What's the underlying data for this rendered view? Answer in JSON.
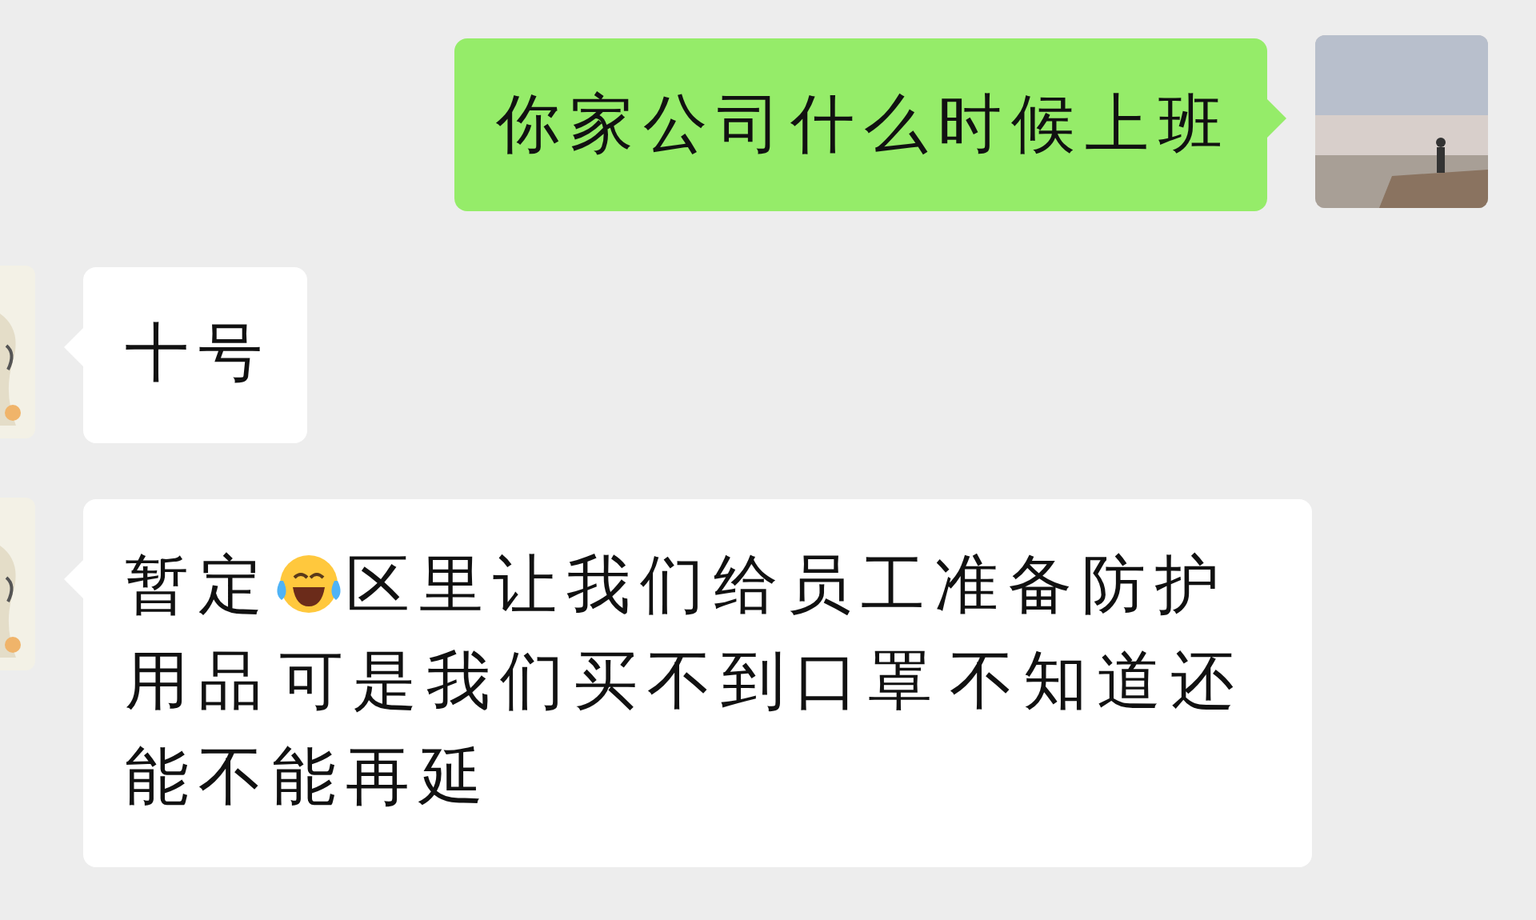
{
  "messages": [
    {
      "kind": "sent",
      "parts": [
        {
          "kind": "text",
          "text": "你家公司什么时候上班"
        }
      ]
    },
    {
      "kind": "received",
      "parts": [
        {
          "kind": "text",
          "text": "十号"
        }
      ]
    },
    {
      "kind": "received",
      "parts": [
        {
          "kind": "text",
          "text": "暂定"
        },
        {
          "kind": "emoji"
        },
        {
          "kind": "text",
          "text": "区里让我们给员工准备防护用品 可是我们买不到口罩 不知道还能不能再延"
        }
      ]
    }
  ]
}
